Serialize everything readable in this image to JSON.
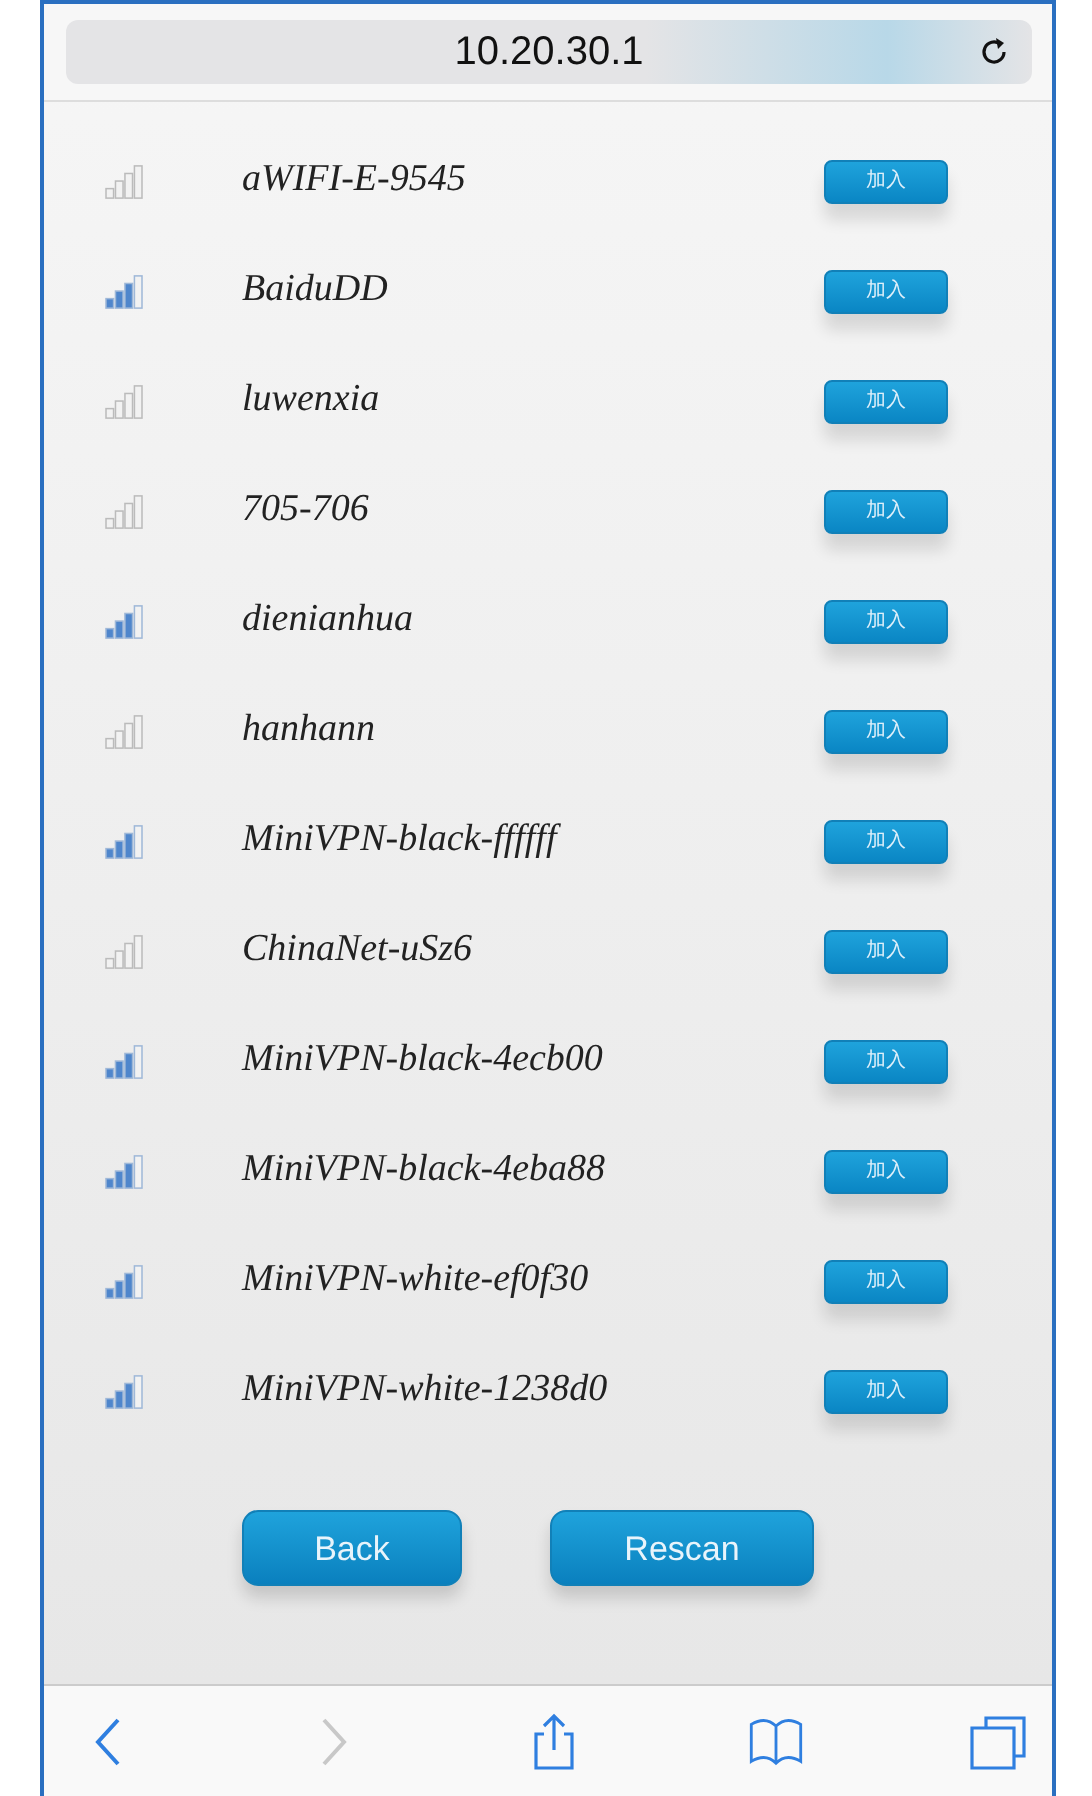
{
  "address_bar": {
    "url": "10.20.30.1"
  },
  "networks": [
    {
      "ssid": "aWIFI-E-9545",
      "strong": false,
      "join": "加入"
    },
    {
      "ssid": "BaiduDD",
      "strong": true,
      "join": "加入"
    },
    {
      "ssid": "luwenxia",
      "strong": false,
      "join": "加入"
    },
    {
      "ssid": "705-706",
      "strong": false,
      "join": "加入"
    },
    {
      "ssid": "dienianhua",
      "strong": true,
      "join": "加入"
    },
    {
      "ssid": "hanhann",
      "strong": false,
      "join": "加入"
    },
    {
      "ssid": "MiniVPN-black-ffffff",
      "strong": true,
      "join": "加入"
    },
    {
      "ssid": "ChinaNet-uSz6",
      "strong": false,
      "join": "加入"
    },
    {
      "ssid": "MiniVPN-black-4ecb00",
      "strong": true,
      "join": "加入"
    },
    {
      "ssid": "MiniVPN-black-4eba88",
      "strong": true,
      "join": "加入"
    },
    {
      "ssid": "MiniVPN-white-ef0f30",
      "strong": true,
      "join": "加入"
    },
    {
      "ssid": "MiniVPN-white-1238d0",
      "strong": true,
      "join": "加入"
    }
  ],
  "buttons": [
    "Back",
    "Rescan"
  ],
  "toolbar": {
    "back_disabled": false,
    "forward_disabled": true
  }
}
